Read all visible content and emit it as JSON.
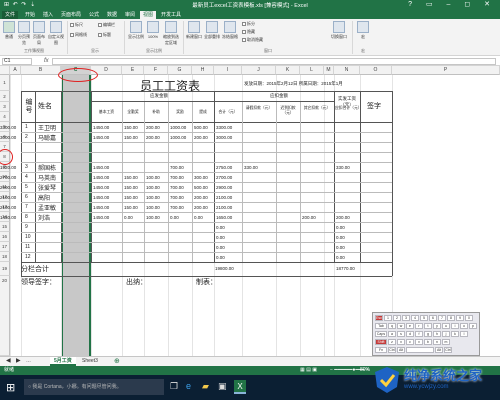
{
  "titlebar": {
    "title": "最新员工excel工资表模板.xls [兼容模式] - Excel",
    "quick_access": "⊞ ↶ ↷ ⇣",
    "controls": "? ▭ – ◻ ✕"
  },
  "ribbon_tabs": [
    "文件",
    "开始",
    "插入",
    "页面布局",
    "公式",
    "数据",
    "审阅",
    "视图",
    "开发工具"
  ],
  "active_tab": "视图",
  "ribbon": {
    "view_buttons": [
      "普通",
      "分页预览",
      "页面布局",
      "自定义视图"
    ],
    "show_checks": [
      "标尺",
      "编辑栏",
      "网格线",
      "标题"
    ],
    "zoom_buttons": [
      "显示比例",
      "100%",
      "缩放到选定区域"
    ],
    "window_buttons": [
      "新建窗口",
      "全部重排",
      "冻结窗格"
    ],
    "window_checks": [
      "拆分",
      "隐藏",
      "取消隐藏"
    ],
    "switch_button": "切换窗口",
    "macro_button": "宏",
    "groups": [
      "工作簿视图",
      "显示",
      "显示比例",
      "窗口",
      "宏"
    ]
  },
  "formula_bar": {
    "name_box": "C1",
    "fx": "fx",
    "value": ""
  },
  "columns": [
    "A",
    "B",
    "C",
    "D",
    "E",
    "F",
    "G",
    "H",
    "I",
    "J",
    "K",
    "L",
    "M",
    "N",
    "O",
    "P"
  ],
  "selected_column": "C",
  "rows": [
    "1",
    "2",
    "3",
    "4",
    "5",
    "6",
    "7",
    "8",
    "9",
    "10",
    "11",
    "12",
    "13",
    "14",
    "15",
    "16",
    "17",
    "18",
    "19",
    "20"
  ],
  "sheet": {
    "title": "员工工资表",
    "date_label": "发放日期：2015年2月12日 所属日期：2015年1月",
    "header_no": "编号",
    "header_name": "姓名",
    "header_sign": "签字",
    "group_payable": "应发金额",
    "group_deduct": "应扣金额",
    "header_actual": "实发工资（元）",
    "sub_headers": [
      "基本工资",
      "全勤奖",
      "补助",
      "奖励",
      "提成",
      "合计（元）",
      "请假扣款（元）",
      "迟到扣款（元）",
      "其它扣款（元）",
      "应扣合计（元）"
    ],
    "employees": [
      {
        "no": "1",
        "name": "王卫明",
        "vals": [
          "1450.00",
          "150.00",
          "200.00",
          "1000.00",
          "500.00",
          "3300.00",
          "",
          "",
          "",
          "",
          "3300.00"
        ]
      },
      {
        "no": "2",
        "name": "马聪嘉",
        "vals": [
          "1450.00",
          "150.00",
          "200.00",
          "1000.00",
          "200.00",
          "3000.00",
          "",
          "",
          "",
          "",
          "3000.00"
        ]
      },
      {
        "no": "3",
        "name": "郝国栋",
        "vals": [
          "1450.00",
          "",
          "",
          "700.00",
          "",
          "2750.00",
          "330.00",
          "",
          "",
          "330.00",
          "1920.00"
        ]
      },
      {
        "no": "4",
        "name": "马英南",
        "vals": [
          "1450.00",
          "150.00",
          "100.00",
          "700.00",
          "300.00",
          "2700.00",
          "",
          "",
          "",
          "",
          "2700.00"
        ]
      },
      {
        "no": "5",
        "name": "张爱琴",
        "vals": [
          "1450.00",
          "150.00",
          "100.00",
          "700.00",
          "500.00",
          "2900.00",
          "",
          "",
          "",
          "",
          "2900.00"
        ]
      },
      {
        "no": "6",
        "name": "高阳",
        "vals": [
          "1450.00",
          "150.00",
          "100.00",
          "700.00",
          "200.00",
          "2100.00",
          "",
          "",
          "",
          "",
          "2100.00"
        ]
      },
      {
        "no": "7",
        "name": "孟亚敏",
        "vals": [
          "1450.00",
          "150.00",
          "100.00",
          "700.00",
          "200.00",
          "2100.00",
          "",
          "",
          "",
          "",
          "2100.00"
        ]
      },
      {
        "no": "8",
        "name": "刘浩",
        "vals": [
          "1450.00",
          "0.00",
          "100.00",
          "0.00",
          "0.00",
          "1650.00",
          "",
          "",
          "200.00",
          "200.00",
          "1450.00"
        ]
      }
    ],
    "zero_rows": [
      {
        "no": "9",
        "total": "0.00",
        "actual": "0.00"
      },
      {
        "no": "10",
        "total": "0.00",
        "actual": "0.00"
      },
      {
        "no": "11",
        "total": "0.00",
        "actual": "0.00"
      },
      {
        "no": "12",
        "total": "0.00",
        "actual": "0.00"
      }
    ],
    "subtotal_label": "分栏合计",
    "subtotal_total": "19800.00",
    "subtotal_actual": "18770.00",
    "footer_leader": "领导签字：",
    "footer_cashier": "出纳：",
    "footer_maker": "制表："
  },
  "sheet_tabs": [
    "5月工资",
    "Sheet3"
  ],
  "active_sheet": "5月工资",
  "status": {
    "left": "就绪",
    "zoom": "80%"
  },
  "taskbar": {
    "search_placeholder": "我是 Cortana，小娜。有问题尽管问我。",
    "time": "14:05"
  },
  "watermark": {
    "text": "纯净系统之家",
    "url": "www.ycwjzy.com"
  },
  "keyboard": {
    "row1": [
      "Esc",
      "1",
      "2",
      "3",
      "4",
      "5",
      "6",
      "7",
      "8",
      "9",
      "0"
    ],
    "row2": [
      "Tab",
      "q",
      "w",
      "e",
      "r",
      "t",
      "y",
      "u",
      "i",
      "o",
      "p"
    ],
    "row3": [
      "Caps",
      "a",
      "s",
      "d",
      "f",
      "g",
      "h",
      "j",
      "k",
      "l"
    ],
    "row4": [
      "Shift",
      "z",
      "x",
      "c",
      "v",
      "b",
      "n",
      "m"
    ],
    "row5": [
      "Fn",
      "Ctrl",
      "Alt",
      "",
      "Alt",
      "Ctrl"
    ]
  },
  "colors": {
    "excel_green": "#217346",
    "highlight_red": "#e02020",
    "selected_column": "#c8c8c8"
  }
}
